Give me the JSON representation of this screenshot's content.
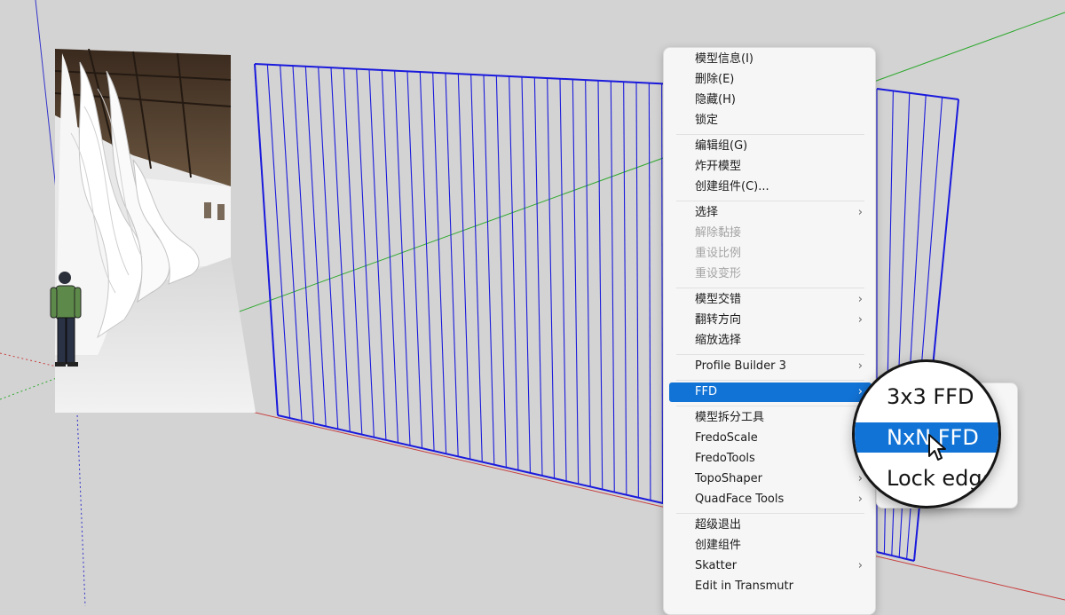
{
  "context_menu": {
    "items": [
      {
        "label": "模型信息(I)",
        "enabled": true,
        "submenu": false
      },
      {
        "label": "删除(E)",
        "enabled": true,
        "submenu": false
      },
      {
        "label": "隐藏(H)",
        "enabled": true,
        "submenu": false
      },
      {
        "label": "锁定",
        "enabled": true,
        "submenu": false
      },
      {
        "label": "编辑组(G)",
        "enabled": true,
        "submenu": false
      },
      {
        "label": "炸开模型",
        "enabled": true,
        "submenu": false
      },
      {
        "label": "创建组件(C)...",
        "enabled": true,
        "submenu": false
      },
      {
        "label": "选择",
        "enabled": true,
        "submenu": true
      },
      {
        "label": "解除黏接",
        "enabled": false,
        "submenu": false
      },
      {
        "label": "重设比例",
        "enabled": false,
        "submenu": false
      },
      {
        "label": "重设变形",
        "enabled": false,
        "submenu": false
      },
      {
        "label": "模型交错",
        "enabled": true,
        "submenu": true
      },
      {
        "label": "翻转方向",
        "enabled": true,
        "submenu": true
      },
      {
        "label": "缩放选择",
        "enabled": true,
        "submenu": false
      },
      {
        "label": "Profile Builder 3",
        "enabled": true,
        "submenu": true
      },
      {
        "label": "FFD",
        "enabled": true,
        "submenu": true,
        "highlighted": true
      },
      {
        "label": "模型拆分工具",
        "enabled": true,
        "submenu": false
      },
      {
        "label": "FredoScale",
        "enabled": true,
        "submenu": true
      },
      {
        "label": "FredoTools",
        "enabled": true,
        "submenu": true
      },
      {
        "label": "TopoShaper",
        "enabled": true,
        "submenu": true
      },
      {
        "label": "QuadFace Tools",
        "enabled": true,
        "submenu": true
      },
      {
        "label": "超级退出",
        "enabled": true,
        "submenu": false
      },
      {
        "label": "创建组件",
        "enabled": true,
        "submenu": false
      },
      {
        "label": "Skatter",
        "enabled": true,
        "submenu": true
      },
      {
        "label": "Edit in Transmutr",
        "enabled": true,
        "submenu": false
      }
    ],
    "submenu_arrow": "›"
  },
  "ffd_submenu": {
    "items": [
      {
        "label": "3x3 FFD"
      },
      {
        "label": "NxN FFD",
        "highlighted": true
      },
      {
        "label": "Lock edges..."
      }
    ]
  },
  "magnifier": {
    "items": [
      {
        "label": "3x3 FFD"
      },
      {
        "label": "NxN FFD",
        "highlighted": true
      },
      {
        "label": "Lock edge"
      }
    ]
  },
  "colors": {
    "background": "#d3d3d3",
    "selection_blue": "#1a1adc",
    "axis_red": "#c84040",
    "axis_green": "#2ea82e",
    "axis_blue": "#3333cc",
    "menu_highlight": "#1273d6"
  },
  "icons": {
    "submenu": "chevron-right-icon",
    "cursor": "mouse-pointer-icon"
  }
}
